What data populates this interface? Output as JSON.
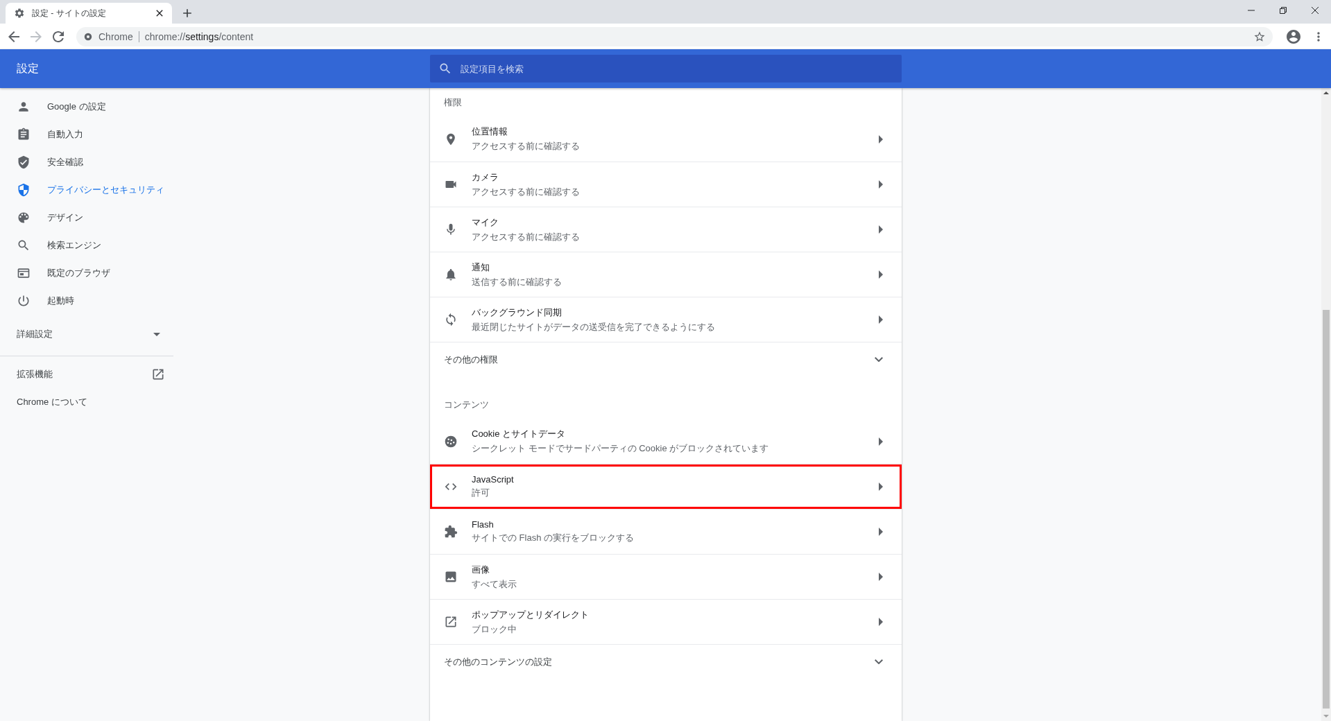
{
  "tab": {
    "title": "設定 - サイトの設定",
    "selected": true
  },
  "toolbar": {
    "nav_buttons": [
      {
        "kind": "back",
        "disabled": false
      },
      {
        "kind": "forward",
        "disabled": true
      },
      {
        "kind": "reload",
        "disabled": false
      }
    ],
    "site_label": "Chrome",
    "url_scheme": "chrome://",
    "url_host": "settings",
    "url_path": "/content"
  },
  "header": {
    "title": "設定",
    "search": {
      "placeholder": "設定項目を検索"
    }
  },
  "sidebar": {
    "items": [
      {
        "label": "Google の設定",
        "selected": false
      },
      {
        "label": "自動入力",
        "selected": false
      },
      {
        "label": "安全確認",
        "selected": false
      },
      {
        "label": "プライバシーとセキュリティ",
        "selected": true
      },
      {
        "label": "デザイン",
        "selected": false
      },
      {
        "label": "検索エンジン",
        "selected": false
      },
      {
        "label": "既定のブラウザ",
        "selected": false
      },
      {
        "label": "起動時",
        "selected": false
      }
    ],
    "advanced": {
      "label": "詳細設定",
      "expanded": false
    },
    "extensions": {
      "label": "拡張機能"
    },
    "about": {
      "label": "Chrome について"
    }
  },
  "sections": [
    {
      "heading": "権限",
      "rows": [
        {
          "kind": "link",
          "title": "位置情報",
          "subtitle": "アクセスする前に確認する",
          "highlighted": false
        },
        {
          "kind": "link",
          "title": "カメラ",
          "subtitle": "アクセスする前に確認する",
          "highlighted": false
        },
        {
          "kind": "link",
          "title": "マイク",
          "subtitle": "アクセスする前に確認する",
          "highlighted": false
        },
        {
          "kind": "link",
          "title": "通知",
          "subtitle": "送信する前に確認する",
          "highlighted": false
        },
        {
          "kind": "link",
          "title": "バックグラウンド同期",
          "subtitle": "最近閉じたサイトがデータの送受信を完了できるようにする",
          "highlighted": false
        },
        {
          "kind": "expand",
          "title": "その他の権限",
          "expanded": false
        }
      ]
    },
    {
      "heading": "コンテンツ",
      "rows": [
        {
          "kind": "link",
          "title": "Cookie とサイトデータ",
          "subtitle": "シークレット モードでサードパーティの Cookie がブロックされています",
          "highlighted": false
        },
        {
          "kind": "link",
          "title": "JavaScript",
          "subtitle": "許可",
          "highlighted": true
        },
        {
          "kind": "link",
          "title": "Flash",
          "subtitle": "サイトでの Flash の実行をブロックする",
          "highlighted": false
        },
        {
          "kind": "link",
          "title": "画像",
          "subtitle": "すべて表示",
          "highlighted": false
        },
        {
          "kind": "link",
          "title": "ポップアップとリダイレクト",
          "subtitle": "ブロック中",
          "highlighted": false
        },
        {
          "kind": "expand",
          "title": "その他のコンテンツの設定",
          "expanded": false
        }
      ]
    }
  ]
}
